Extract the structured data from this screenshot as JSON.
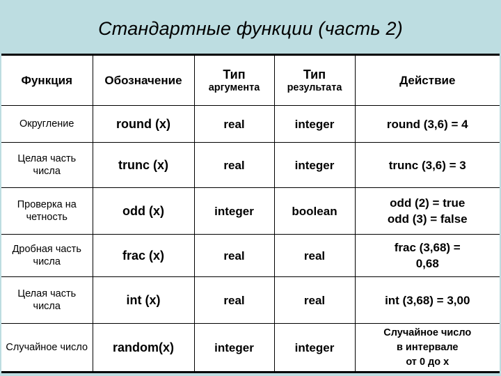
{
  "slide": {
    "title": "Стандартные функции (часть 2)",
    "background_color": "#bddde1",
    "table_background_color": "#ffffff",
    "text_color": "#000000"
  },
  "table": {
    "headers": {
      "function": "Функция",
      "notation": "Обозначение",
      "arg_type_line1": "Тип",
      "arg_type_line2": "аргумента",
      "result_type_line1": "Тип",
      "result_type_line2": "результата",
      "action": "Действие"
    },
    "rows": [
      {
        "name": "Округление",
        "notation": "round (x)",
        "arg_type": "real",
        "result_type": "integer",
        "action_lines": [
          "round (3,6) = 4"
        ],
        "action_small": false
      },
      {
        "name": "Целая часть числа",
        "notation": "trunc (x)",
        "arg_type": "real",
        "result_type": "integer",
        "action_lines": [
          "trunc (3,6) = 3"
        ],
        "action_small": false
      },
      {
        "name": "Проверка на четность",
        "notation": "odd (x)",
        "arg_type": "integer",
        "result_type": "boolean",
        "action_lines": [
          "odd (2) = true",
          "odd (3) = false"
        ],
        "action_small": false
      },
      {
        "name": "Дробная часть числа",
        "notation": "frac (x)",
        "arg_type": "real",
        "result_type": "real",
        "action_lines": [
          "frac (3,68) =",
          "0,68"
        ],
        "action_small": false
      },
      {
        "name": "Целая часть числа",
        "notation": "int (x)",
        "arg_type": "real",
        "result_type": "real",
        "action_lines": [
          "int (3,68) = 3,00"
        ],
        "action_small": false
      },
      {
        "name": "Случайное число",
        "notation": "random(x)",
        "arg_type": "integer",
        "result_type": "integer",
        "action_lines": [
          "Случайное число",
          "в интервале",
          "от 0 до х"
        ],
        "action_small": true
      }
    ]
  }
}
